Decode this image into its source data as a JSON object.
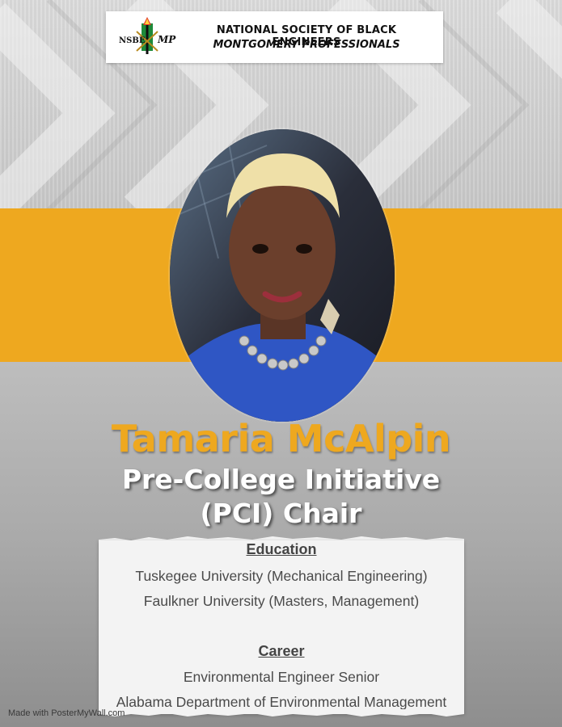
{
  "header": {
    "logo_text_left": "NSBE",
    "logo_text_right": "MP",
    "org_name_line1": "NATIONAL SOCIETY OF BLACK ENGINEERS",
    "org_name_line2": "MONTGOMERY PROFESSIONALS"
  },
  "profile": {
    "name": "Tamaria McAlpin",
    "role_line1": "Pre-College Initiative",
    "role_line2": "(PCI) Chair"
  },
  "education": {
    "heading": "Education",
    "items": [
      "Tuskegee University (Mechanical Engineering)",
      "Faulkner University (Masters, Management)"
    ]
  },
  "career": {
    "heading": "Career",
    "items": [
      "Environmental Engineer Senior",
      "Alabama Department of Environmental Management"
    ]
  },
  "footer": {
    "watermark": "Made with PosterMyWall.com"
  },
  "colors": {
    "accent_gold": "#eea81f",
    "background_gray": "#bdbdbd",
    "card_bg": "#f3f3f3",
    "shirt_blue": "#2f56c4"
  },
  "icons": {
    "logo": "nsbe-torch-logo"
  }
}
